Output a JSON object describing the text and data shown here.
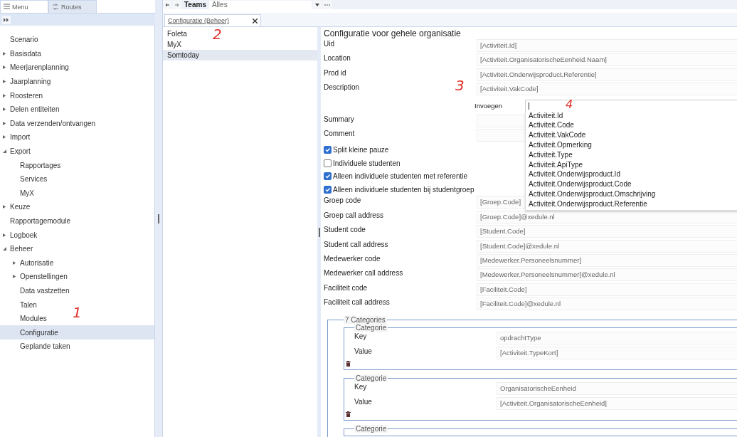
{
  "left_tabs": [
    {
      "label": "Menu",
      "selected": true
    },
    {
      "label": "Routes",
      "selected": false
    }
  ],
  "menu": [
    {
      "label": "Scenario",
      "kind": "leaf",
      "selected": false
    },
    {
      "label": "Basisdata",
      "kind": "group",
      "expanded": false,
      "selected": false
    },
    {
      "label": "Meerjarenplanning",
      "kind": "group",
      "expanded": false,
      "selected": false
    },
    {
      "label": "Jaarplanning",
      "kind": "group",
      "expanded": false,
      "selected": false
    },
    {
      "label": "Roosteren",
      "kind": "group",
      "expanded": false,
      "selected": false
    },
    {
      "label": "Delen entiteiten",
      "kind": "group",
      "expanded": false,
      "selected": false
    },
    {
      "label": "Data verzenden/ontvangen",
      "kind": "group",
      "expanded": false,
      "selected": false
    },
    {
      "label": "Import",
      "kind": "group",
      "expanded": false,
      "selected": false
    },
    {
      "label": "Export",
      "kind": "group",
      "expanded": true,
      "selected": false,
      "children": [
        {
          "label": "Rapportages",
          "kind": "leaf",
          "selected": false
        },
        {
          "label": "Services",
          "kind": "leaf",
          "selected": false
        },
        {
          "label": "MyX",
          "kind": "leaf",
          "selected": false
        }
      ]
    },
    {
      "label": "Keuze",
      "kind": "group",
      "expanded": false,
      "selected": false
    },
    {
      "label": "Rapportagemodule",
      "kind": "leaf",
      "selected": false
    },
    {
      "label": "Logboek",
      "kind": "group",
      "expanded": false,
      "selected": false
    },
    {
      "label": "Beheer",
      "kind": "group",
      "expanded": true,
      "selected": false,
      "children": [
        {
          "label": "Autorisatie",
          "kind": "group",
          "expanded": false,
          "selected": false
        },
        {
          "label": "Openstellingen",
          "kind": "group",
          "expanded": false,
          "selected": false
        },
        {
          "label": "Data vastzetten",
          "kind": "leaf",
          "selected": false
        },
        {
          "label": "Talen",
          "kind": "leaf",
          "selected": false
        },
        {
          "label": "Modules",
          "kind": "leaf",
          "selected": false
        },
        {
          "label": "Configuratie",
          "kind": "leaf",
          "selected": true
        },
        {
          "label": "Geplande taken",
          "kind": "leaf",
          "selected": false
        }
      ]
    }
  ],
  "top_bar": {
    "label": "Teams",
    "filter": "Alles"
  },
  "doc_tab": {
    "label": "Configuratie (Beheer)",
    "selected": true
  },
  "systems": [
    {
      "label": "Foleta",
      "selected": false
    },
    {
      "label": "MyX",
      "selected": false
    },
    {
      "label": "Somtoday",
      "selected": true
    }
  ],
  "form": {
    "title": "Configuratie voor gehele organisatie",
    "fields": [
      {
        "kind": "text",
        "label": "Uid",
        "value": "[Activiteit.Id]"
      },
      {
        "kind": "text",
        "label": "Location",
        "value": "[Activiteit.OrganisatorischeEenheid.Naam]"
      },
      {
        "kind": "text",
        "label": "Prod id",
        "value": "[Activiteit.Onderwijsproduct.Referentie]"
      },
      {
        "kind": "text",
        "label": "Description",
        "value": "[Activiteit.VakCode]"
      },
      {
        "kind": "insert",
        "label": "Invoegen"
      },
      {
        "kind": "text",
        "label": "Summary"
      },
      {
        "kind": "text",
        "label": "Comment"
      },
      {
        "kind": "checkbox",
        "label": "Split kleine pauze",
        "checked": true
      },
      {
        "kind": "checkbox",
        "label": "Individuele studenten",
        "checked": false
      },
      {
        "kind": "checkbox",
        "label": "Alleen individuele studenten met referentie",
        "checked": true
      },
      {
        "kind": "checkbox",
        "label": "Alleen individuele studenten bij studentgroep",
        "checked": true
      },
      {
        "kind": "text",
        "label": "Groep code",
        "value": "[Groep.Code]"
      },
      {
        "kind": "text",
        "label": "Groep call address",
        "value": "[Groep.Code]@xedule.nl"
      },
      {
        "kind": "text",
        "label": "Student code",
        "value": "[Student.Code]"
      },
      {
        "kind": "text",
        "label": "Student call address",
        "value": "[Student.Code]@xedule.nl"
      },
      {
        "kind": "text",
        "label": "Medewerker code",
        "value": "[Medewerker.Personeelsnummer]"
      },
      {
        "kind": "text",
        "label": "Medewerker call address",
        "value": "[Medewerker.Personeelsnummer]@xedule.nl"
      },
      {
        "kind": "text",
        "label": "Faciliteit code",
        "value": "[Faciliteit.Code]"
      },
      {
        "kind": "text",
        "label": "Faciliteit call address",
        "value": "[Faciliteit.Code]@xedule.nl"
      }
    ],
    "suggestions": [
      "Activiteit.Id",
      "Activiteit.Code",
      "Activiteit.VakCode",
      "Activiteit.Opmerking",
      "Activiteit.Type",
      "Activiteit.ApiType",
      "Activiteit.Onderwijsproduct.Id",
      "Activiteit.Onderwijsproduct.Code",
      "Activiteit.Onderwijsproduct.Omschrijving",
      "Activiteit.Onderwijsproduct.Referentie"
    ],
    "categories": {
      "legend": "7 Categories",
      "items": [
        {
          "legend": "Categorie",
          "key_label": "Key",
          "key": "opdrachtType",
          "value_label": "Value",
          "value": "[Activiteit.TypeKort]"
        },
        {
          "legend": "Categorie",
          "key_label": "Key",
          "key": "OrganisatorischeEenheid",
          "value_label": "Value",
          "value": "[Activiteit.OrganisatorischeEenheid]"
        },
        {
          "legend": "Categorie"
        }
      ]
    }
  },
  "annotations": [
    "1",
    "2",
    "3",
    "4"
  ]
}
